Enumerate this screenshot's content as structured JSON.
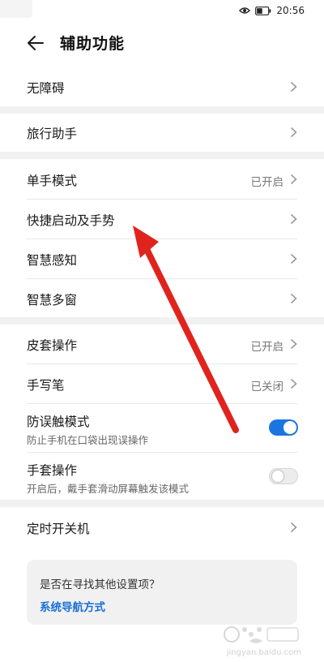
{
  "status_bar": {
    "time": "20:56"
  },
  "header": {
    "title": "辅助功能"
  },
  "rows": [
    {
      "label": "无障碍"
    },
    {
      "label": "旅行助手"
    },
    {
      "label": "单手模式",
      "value": "已开启"
    },
    {
      "label": "快捷启动及手势"
    },
    {
      "label": "智慧感知"
    },
    {
      "label": "智慧多窗"
    },
    {
      "label": "皮套操作",
      "value": "已开启"
    },
    {
      "label": "手写笔",
      "value": "已关闭"
    },
    {
      "label": "防误触模式",
      "sub": "防止手机在口袋出现误操作",
      "toggle": true
    },
    {
      "label": "手套操作",
      "sub": "开启后，戴手套滑动屏幕触发该模式",
      "toggle": false
    },
    {
      "label": "定时开关机"
    }
  ],
  "card": {
    "title": "是否在寻找其他设置项？",
    "link": "系统导航方式"
  },
  "watermark": {
    "text": "jingyan.baidu.com"
  },
  "colors": {
    "accent": "#1b75e0",
    "arrow": "#e0241d",
    "link": "#1b6fd6"
  }
}
